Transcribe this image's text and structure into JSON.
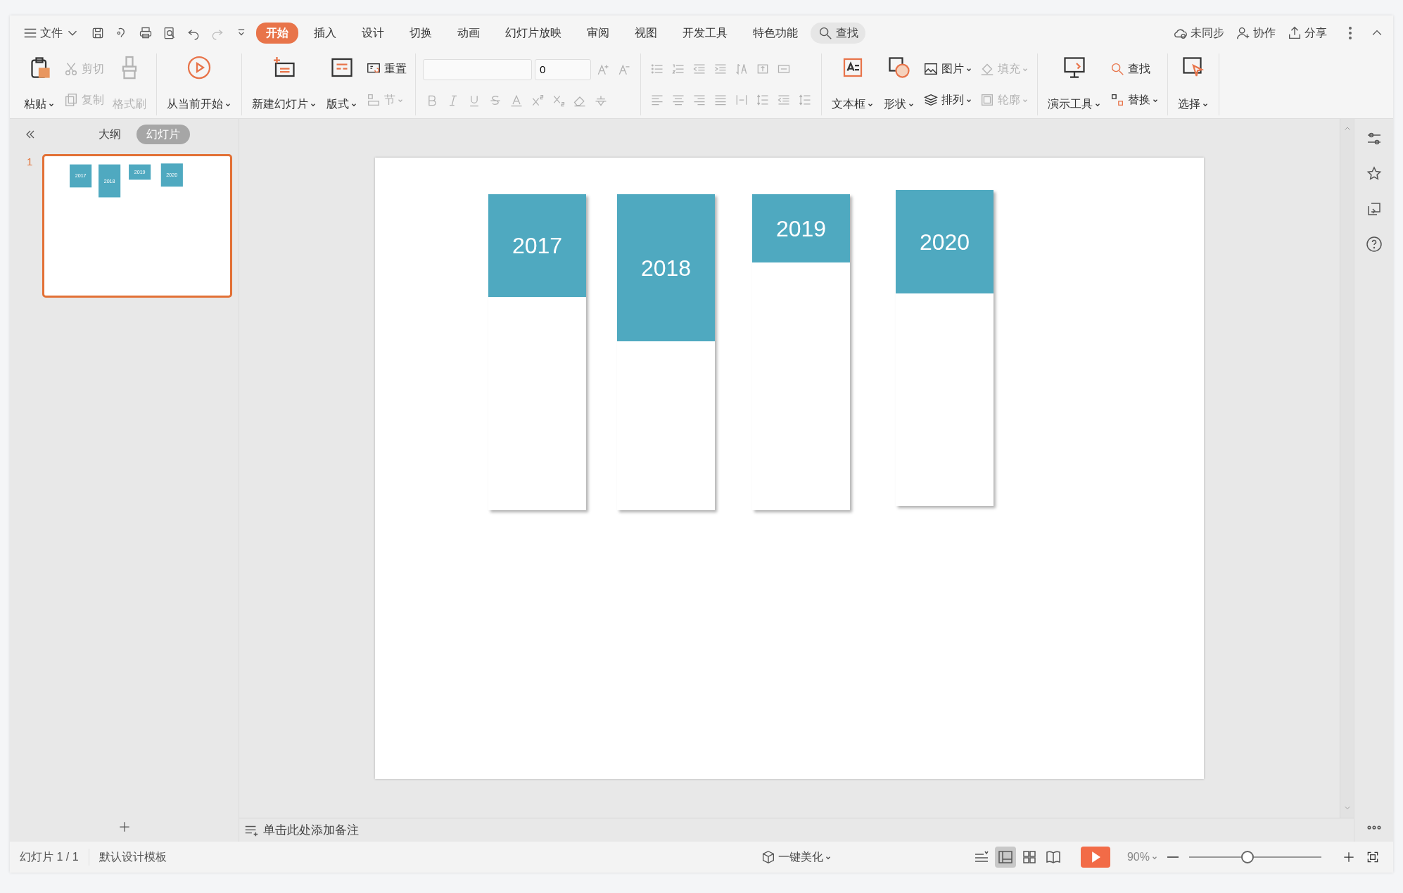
{
  "title_bar": {
    "file_menu": "文件",
    "tabs": [
      {
        "label": "开始",
        "selected": true
      },
      {
        "label": "插入",
        "selected": false
      },
      {
        "label": "设计",
        "selected": false
      },
      {
        "label": "切换",
        "selected": false
      },
      {
        "label": "动画",
        "selected": false
      },
      {
        "label": "幻灯片放映",
        "selected": false
      },
      {
        "label": "审阅",
        "selected": false
      },
      {
        "label": "视图",
        "selected": false
      },
      {
        "label": "开发工具",
        "selected": false
      },
      {
        "label": "特色功能",
        "selected": false
      }
    ],
    "search": "查找",
    "actions": [
      "未同步",
      "协作",
      "分享"
    ]
  },
  "ribbon": {
    "font_size": "0",
    "groups": [
      {
        "columns": [
          {
            "kind": "large",
            "label": "粘贴",
            "dropdown": true,
            "disabled": false
          },
          {
            "kind": "stack",
            "items": [
              {
                "label": "剪切",
                "dropdown": false,
                "disabled": true
              },
              {
                "label": "复制",
                "dropdown": false,
                "disabled": true
              }
            ]
          },
          {
            "kind": "large",
            "label": "格式刷",
            "dropdown": false,
            "disabled": true
          }
        ]
      },
      {
        "columns": [
          {
            "kind": "large",
            "label": "从当前开始",
            "dropdown": true,
            "disabled": false
          }
        ]
      },
      {
        "columns": [
          {
            "kind": "large",
            "label": "新建幻灯片",
            "dropdown": true,
            "disabled": false
          },
          {
            "kind": "large",
            "label": "版式",
            "dropdown": true,
            "disabled": false
          },
          {
            "kind": "stack",
            "items": [
              {
                "label": "重置",
                "dropdown": false,
                "disabled": false
              },
              {
                "label": "节",
                "dropdown": true,
                "disabled": true
              }
            ]
          }
        ]
      },
      {
        "columns": [
          {
            "kind": "font"
          }
        ]
      },
      {
        "columns": [
          {
            "kind": "paragraph"
          }
        ]
      },
      {
        "columns": [
          {
            "kind": "large",
            "label": "文本框",
            "dropdown": true,
            "disabled": false
          },
          {
            "kind": "large",
            "label": "形状",
            "dropdown": true,
            "disabled": false
          },
          {
            "kind": "stack",
            "items": [
              {
                "label": "图片",
                "dropdown": true,
                "disabled": false
              },
              {
                "label": "排列",
                "dropdown": true,
                "disabled": false
              }
            ]
          },
          {
            "kind": "stack",
            "items": [
              {
                "label": "填充",
                "dropdown": true,
                "disabled": true
              },
              {
                "label": "轮廓",
                "dropdown": true,
                "disabled": true
              }
            ]
          }
        ]
      },
      {
        "columns": [
          {
            "kind": "large",
            "label": "演示工具",
            "dropdown": true,
            "disabled": false
          },
          {
            "kind": "stack",
            "items": [
              {
                "label": "查找",
                "dropdown": false,
                "disabled": false
              },
              {
                "label": "替换",
                "dropdown": true,
                "disabled": false
              }
            ]
          }
        ]
      },
      {
        "columns": [
          {
            "kind": "large",
            "label": "选择",
            "dropdown": true,
            "disabled": false
          }
        ]
      }
    ]
  },
  "side_panel": {
    "tabs": [
      {
        "label": "大纲",
        "selected": false
      },
      {
        "label": "幻灯片",
        "selected": true
      }
    ],
    "slides": [
      {
        "number": "1",
        "selected": true,
        "cards": [
          {
            "year": "2017"
          },
          {
            "year": "2018"
          },
          {
            "year": "2019"
          },
          {
            "year": "2020"
          }
        ]
      }
    ]
  },
  "slide": {
    "cards": [
      {
        "year": "2017"
      },
      {
        "year": "2018"
      },
      {
        "year": "2019"
      },
      {
        "year": "2020"
      }
    ]
  },
  "notes": {
    "placeholder": "单击此处添加备注"
  },
  "status_bar": {
    "slide_count": "幻灯片 1 / 1",
    "template": "默认设计模板",
    "beautify": "一键美化",
    "views": [
      {
        "selected": true
      },
      {
        "selected": false
      },
      {
        "selected": false
      }
    ],
    "zoom": "90%",
    "zoom_slider": {
      "level": 0.44
    }
  }
}
